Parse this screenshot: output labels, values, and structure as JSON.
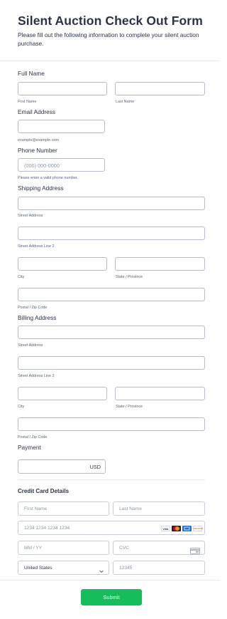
{
  "header": {
    "title": "Silent Auction Check Out Form",
    "subtitle": "Please fill out the following information to complete your silent auction purchase."
  },
  "full_name": {
    "label": "Full Name",
    "first_sub": "First Name",
    "last_sub": "Last Name"
  },
  "email": {
    "label": "Email Address",
    "sub": "example@example.com"
  },
  "phone": {
    "label": "Phone Number",
    "placeholder": "(000) 000-0000",
    "sub": "Please enter a valid phone number."
  },
  "shipping": {
    "label": "Shipping Address",
    "street": "Street Address",
    "street2": "Street Address Line 2",
    "city": "City",
    "state": "State / Province",
    "zip": "Postal / Zip Code"
  },
  "billing": {
    "label": "Billing Address",
    "street": "Street Address",
    "street2": "Street Address Line 2",
    "city": "City",
    "state": "State / Province",
    "zip": "Postal / Zip Code"
  },
  "payment": {
    "label": "Payment",
    "currency": "USD"
  },
  "credit_card": {
    "heading": "Credit Card Details",
    "first_name": "First Name",
    "last_name": "Last Name",
    "card_number": "1234 1234 1234 1234",
    "expiry": "MM / YY",
    "cvc": "CVC",
    "country": "United States",
    "zip": "12345",
    "brands": [
      "VISA",
      "mastercard",
      "amex",
      "DISCOVER"
    ]
  },
  "submit_label": "Submit",
  "colors": {
    "submit": "#18bd5b",
    "text": "#2c3345",
    "border": "#b8bdc9"
  }
}
